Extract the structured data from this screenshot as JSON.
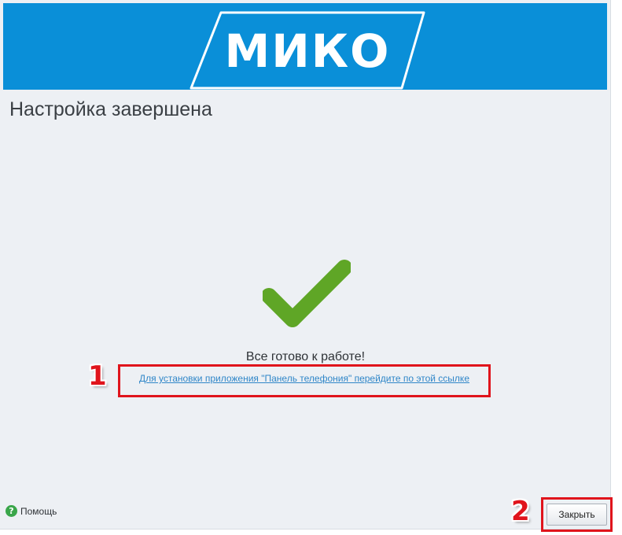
{
  "banner": {
    "logo_text": "МИКО",
    "background_color": "#0a8fd8"
  },
  "page": {
    "title": "Настройка завершена",
    "success_icon": "checkmark-icon",
    "success_color": "#5fa626",
    "ready_text": "Все готово к работе!",
    "install_link": "Для установки приложения \"Панель телефония\" перейдите по этой ссылке"
  },
  "annotations": {
    "marker_1": "1",
    "marker_2": "2",
    "highlight_color": "#e0141c"
  },
  "footer": {
    "help_icon": "question-icon",
    "help_icon_glyph": "?",
    "help_label": "Помощь",
    "close_label": "Закрыть"
  }
}
